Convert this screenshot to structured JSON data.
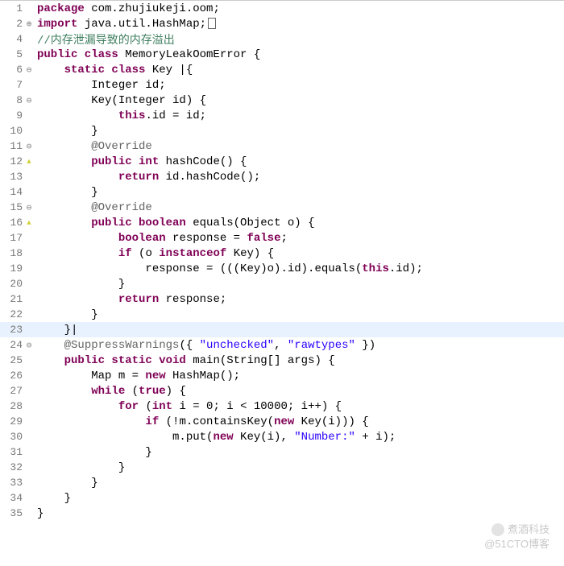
{
  "watermark": {
    "line1": "煮酒科技",
    "line2": "@51CTO博客"
  },
  "lines": [
    {
      "n": 1,
      "m": "",
      "tokens": [
        {
          "t": "package ",
          "c": "kw"
        },
        {
          "t": "com.zhujiukeji.oom;",
          "c": ""
        }
      ]
    },
    {
      "n": 2,
      "m": "plus",
      "tokens": [
        {
          "t": "import ",
          "c": "kw"
        },
        {
          "t": "java.util.HashMap;",
          "c": ""
        },
        {
          "t": "[box]",
          "c": "box"
        }
      ]
    },
    {
      "n": 4,
      "m": "",
      "tokens": [
        {
          "t": "//内存泄漏导致的内存溢出",
          "c": "comment"
        }
      ]
    },
    {
      "n": 5,
      "m": "",
      "tokens": [
        {
          "t": "public class ",
          "c": "kw"
        },
        {
          "t": "MemoryLeakOomError {",
          "c": ""
        }
      ]
    },
    {
      "n": 6,
      "m": "minus",
      "tokens": [
        {
          "t": "    ",
          "c": ""
        },
        {
          "t": "static class ",
          "c": "kw"
        },
        {
          "t": "Key |{",
          "c": ""
        }
      ]
    },
    {
      "n": 7,
      "m": "",
      "tokens": [
        {
          "t": "        Integer id;",
          "c": ""
        }
      ]
    },
    {
      "n": 8,
      "m": "minus",
      "tokens": [
        {
          "t": "        Key(Integer id) {",
          "c": ""
        }
      ]
    },
    {
      "n": 9,
      "m": "",
      "tokens": [
        {
          "t": "            ",
          "c": ""
        },
        {
          "t": "this",
          "c": "kw"
        },
        {
          "t": ".id = id;",
          "c": ""
        }
      ]
    },
    {
      "n": 10,
      "m": "",
      "tokens": [
        {
          "t": "        }",
          "c": ""
        }
      ]
    },
    {
      "n": 11,
      "m": "minus",
      "tokens": [
        {
          "t": "        ",
          "c": ""
        },
        {
          "t": "@Override",
          "c": "ann"
        }
      ]
    },
    {
      "n": 12,
      "m": "warn",
      "tokens": [
        {
          "t": "        ",
          "c": ""
        },
        {
          "t": "public int ",
          "c": "kw"
        },
        {
          "t": "hashCode() {",
          "c": ""
        }
      ]
    },
    {
      "n": 13,
      "m": "",
      "tokens": [
        {
          "t": "            ",
          "c": ""
        },
        {
          "t": "return ",
          "c": "kw"
        },
        {
          "t": "id.hashCode();",
          "c": ""
        }
      ]
    },
    {
      "n": 14,
      "m": "",
      "tokens": [
        {
          "t": "        }",
          "c": ""
        }
      ]
    },
    {
      "n": 15,
      "m": "minus",
      "tokens": [
        {
          "t": "        ",
          "c": ""
        },
        {
          "t": "@Override",
          "c": "ann"
        }
      ]
    },
    {
      "n": 16,
      "m": "warn",
      "tokens": [
        {
          "t": "        ",
          "c": ""
        },
        {
          "t": "public boolean ",
          "c": "kw"
        },
        {
          "t": "equals(Object o) {",
          "c": ""
        }
      ]
    },
    {
      "n": 17,
      "m": "",
      "tokens": [
        {
          "t": "            ",
          "c": ""
        },
        {
          "t": "boolean ",
          "c": "kw"
        },
        {
          "t": "response = ",
          "c": ""
        },
        {
          "t": "false",
          "c": "kw"
        },
        {
          "t": ";",
          "c": ""
        }
      ]
    },
    {
      "n": 18,
      "m": "",
      "tokens": [
        {
          "t": "            ",
          "c": ""
        },
        {
          "t": "if ",
          "c": "kw"
        },
        {
          "t": "(o ",
          "c": ""
        },
        {
          "t": "instanceof ",
          "c": "kw"
        },
        {
          "t": "Key) {",
          "c": ""
        }
      ]
    },
    {
      "n": 19,
      "m": "",
      "tokens": [
        {
          "t": "                response = (((Key)o).id).equals(",
          "c": ""
        },
        {
          "t": "this",
          "c": "kw"
        },
        {
          "t": ".id);",
          "c": ""
        }
      ]
    },
    {
      "n": 20,
      "m": "",
      "tokens": [
        {
          "t": "            }",
          "c": ""
        }
      ]
    },
    {
      "n": 21,
      "m": "",
      "tokens": [
        {
          "t": "            ",
          "c": ""
        },
        {
          "t": "return ",
          "c": "kw"
        },
        {
          "t": "response;",
          "c": ""
        }
      ]
    },
    {
      "n": 22,
      "m": "",
      "tokens": [
        {
          "t": "        }",
          "c": ""
        }
      ]
    },
    {
      "n": 23,
      "m": "",
      "hl": true,
      "tokens": [
        {
          "t": "    }|",
          "c": ""
        }
      ]
    },
    {
      "n": 24,
      "m": "minus",
      "tokens": [
        {
          "t": "    ",
          "c": ""
        },
        {
          "t": "@SuppressWarnings",
          "c": "ann"
        },
        {
          "t": "({ ",
          "c": ""
        },
        {
          "t": "\"unchecked\"",
          "c": "str"
        },
        {
          "t": ", ",
          "c": ""
        },
        {
          "t": "\"rawtypes\"",
          "c": "str"
        },
        {
          "t": " })",
          "c": ""
        }
      ]
    },
    {
      "n": 25,
      "m": "",
      "tokens": [
        {
          "t": "    ",
          "c": ""
        },
        {
          "t": "public static void ",
          "c": "kw"
        },
        {
          "t": "main(String[] args) {",
          "c": ""
        }
      ]
    },
    {
      "n": 26,
      "m": "",
      "tokens": [
        {
          "t": "        Map m = ",
          "c": ""
        },
        {
          "t": "new ",
          "c": "kw"
        },
        {
          "t": "HashMap();",
          "c": ""
        }
      ]
    },
    {
      "n": 27,
      "m": "",
      "tokens": [
        {
          "t": "        ",
          "c": ""
        },
        {
          "t": "while ",
          "c": "kw"
        },
        {
          "t": "(",
          "c": ""
        },
        {
          "t": "true",
          "c": "kw"
        },
        {
          "t": ") {",
          "c": ""
        }
      ]
    },
    {
      "n": 28,
      "m": "",
      "tokens": [
        {
          "t": "            ",
          "c": ""
        },
        {
          "t": "for ",
          "c": "kw"
        },
        {
          "t": "(",
          "c": ""
        },
        {
          "t": "int ",
          "c": "kw"
        },
        {
          "t": "i = 0; i < 10000; i++) {",
          "c": ""
        }
      ]
    },
    {
      "n": 29,
      "m": "",
      "tokens": [
        {
          "t": "                ",
          "c": ""
        },
        {
          "t": "if ",
          "c": "kw"
        },
        {
          "t": "(!m.containsKey(",
          "c": ""
        },
        {
          "t": "new ",
          "c": "kw"
        },
        {
          "t": "Key(i))) {",
          "c": ""
        }
      ]
    },
    {
      "n": 30,
      "m": "",
      "tokens": [
        {
          "t": "                    m.put(",
          "c": ""
        },
        {
          "t": "new ",
          "c": "kw"
        },
        {
          "t": "Key(i), ",
          "c": ""
        },
        {
          "t": "\"Number:\"",
          "c": "str"
        },
        {
          "t": " + i);",
          "c": ""
        }
      ]
    },
    {
      "n": 31,
      "m": "",
      "tokens": [
        {
          "t": "                }",
          "c": ""
        }
      ]
    },
    {
      "n": 32,
      "m": "",
      "tokens": [
        {
          "t": "            }",
          "c": ""
        }
      ]
    },
    {
      "n": 33,
      "m": "",
      "tokens": [
        {
          "t": "        }",
          "c": ""
        }
      ]
    },
    {
      "n": 34,
      "m": "",
      "tokens": [
        {
          "t": "    }",
          "c": ""
        }
      ]
    },
    {
      "n": 35,
      "m": "",
      "tokens": [
        {
          "t": "}",
          "c": ""
        }
      ]
    }
  ]
}
